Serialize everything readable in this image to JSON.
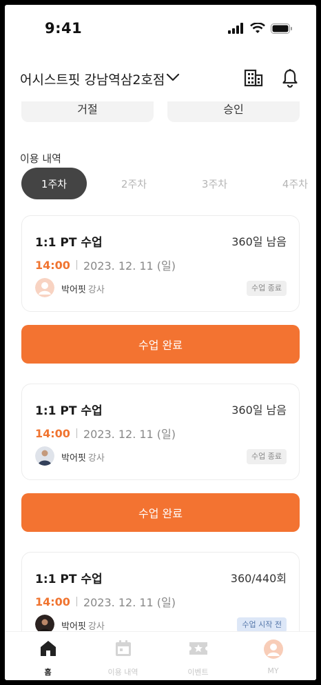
{
  "status_bar": {
    "time": "9:41"
  },
  "header": {
    "branch_name": "어시스트핏 강남역삼2호점"
  },
  "actions": {
    "reject_label": "거절",
    "approve_label": "승인"
  },
  "usage": {
    "title": "이용 내역",
    "weeks": [
      "1주차",
      "2주차",
      "3주차",
      "4주차"
    ],
    "active_week": 0
  },
  "sessions": [
    {
      "title": "1:1 PT 수업",
      "remaining": "360일 남음",
      "time": "14:00",
      "date": "2023. 12. 11 (일)",
      "instructor": "박어핏",
      "role": "강사",
      "status": "수업 종료",
      "button": "수업 완료"
    },
    {
      "title": "1:1 PT 수업",
      "remaining": "360일 남음",
      "time": "14:00",
      "date": "2023. 12. 11 (일)",
      "instructor": "박어핏",
      "role": "강사",
      "status": "수업 종료",
      "button": "수업 완료"
    },
    {
      "title": "1:1 PT 수업",
      "remaining": "360/440회",
      "time": "14:00",
      "date": "2023. 12. 11 (일)",
      "instructor": "박어핏",
      "role": "강사",
      "status": "수업 시작 전"
    }
  ],
  "tabbar": {
    "items": [
      {
        "label": "홈",
        "icon": "home-icon"
      },
      {
        "label": "이용 내역",
        "icon": "calendar-icon"
      },
      {
        "label": "이벤트",
        "icon": "ticket-icon"
      },
      {
        "label": "MY",
        "icon": "profile-icon"
      }
    ]
  },
  "colors": {
    "accent": "#f37331",
    "dark_chip": "#444444",
    "badge_blue_bg": "#dde7f7"
  }
}
